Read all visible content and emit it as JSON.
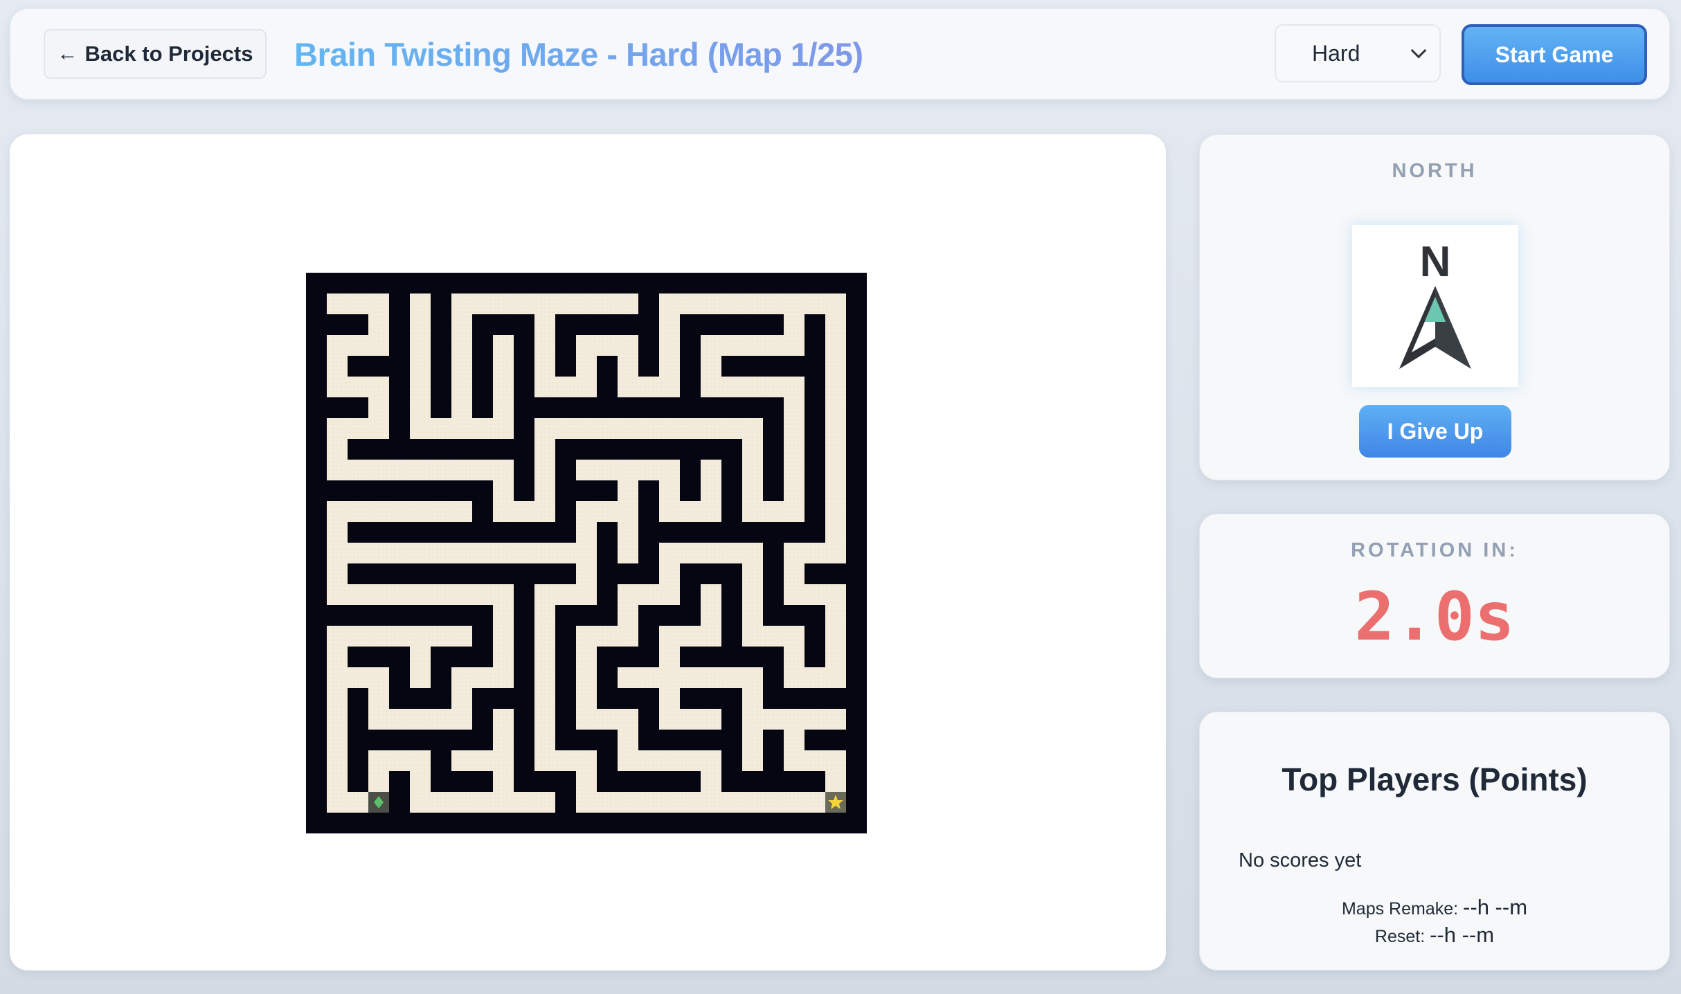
{
  "header": {
    "back_label": "Back to Projects",
    "title": "Brain Twisting Maze - Hard (Map 1/25)",
    "difficulty_selected": "Hard",
    "start_label": "Start Game"
  },
  "compass": {
    "label": "NORTH",
    "letter": "N",
    "give_up_label": "I Give Up"
  },
  "timer": {
    "label": "ROTATION IN:",
    "value": "2.0s"
  },
  "scores": {
    "title": "Top Players (Points)",
    "empty_text": "No scores yet",
    "maps_remake_label": "Maps Remake:",
    "maps_remake_value": "--h --m",
    "reset_label": "Reset:",
    "reset_value": "--h --m"
  },
  "maze": {
    "wall_color": "#060612",
    "path_color": "#f3ecdc",
    "start_icon": "player-icon",
    "goal_icon": "star-icon"
  }
}
